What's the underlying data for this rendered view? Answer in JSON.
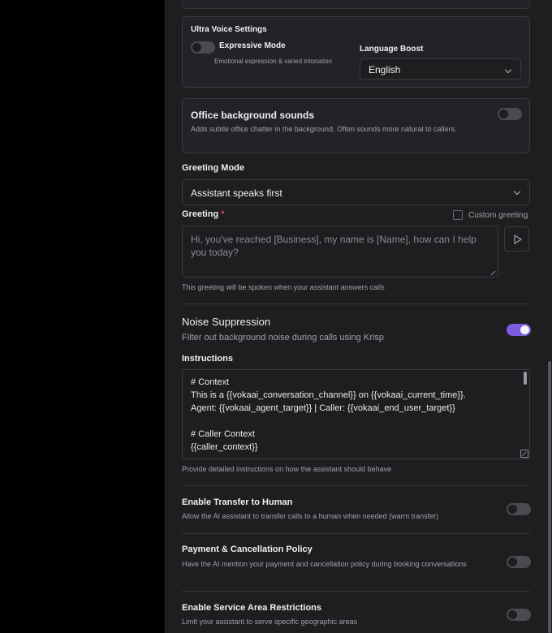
{
  "ultra_voice": {
    "heading": "Ultra Voice Settings",
    "expressive_mode": {
      "label": "Expressive Mode",
      "description": "Emotional expression & varied intonation",
      "enabled": false
    },
    "language_boost": {
      "label": "Language Boost",
      "value": "English"
    }
  },
  "office_sounds": {
    "title": "Office background sounds",
    "description": "Adds subtle office chatter in the background. Often sounds more natural to callers.",
    "enabled": false
  },
  "greeting_mode": {
    "label": "Greeting Mode",
    "value": "Assistant speaks first"
  },
  "greeting": {
    "label": "Greeting",
    "required_mark": "*",
    "custom_label": "Custom greeting",
    "custom_checked": false,
    "placeholder": "Hi, you've reached [Business], my name is [Name], how can I help you today?",
    "hint": "This greeting will be spoken when your assistant answers calls"
  },
  "noise_suppression": {
    "title": "Noise Suppression",
    "description": "Filter out background noise during calls using Krisp",
    "enabled": true
  },
  "instructions": {
    "label": "Instructions",
    "lines": [
      "# Context",
      "This is a {{vokaai_conversation_channel}} on {{vokaai_current_time}}.",
      "Agent: {{vokaai_agent_target}} | Caller: {{vokaai_end_user_target}}",
      "",
      "# Caller Context",
      "{{caller_context}}"
    ],
    "hint": "Provide detailed instructions on how the assistant should behave"
  },
  "transfer_to_human": {
    "title": "Enable Transfer to Human",
    "description": "Allow the AI assistant to transfer calls to a human when needed (warm transfer)",
    "enabled": false
  },
  "payment_policy": {
    "title": "Payment & Cancellation Policy",
    "description": "Have the AI mention your payment and cancellation policy during booking conversations",
    "enabled": false
  },
  "service_area": {
    "title": "Enable Service Area Restrictions",
    "description": "Limit your assistant to serve specific geographic areas",
    "enabled": false
  },
  "colors": {
    "accent": "#7c5ce0",
    "panel": "#1e1e21",
    "backdrop": "#000000"
  }
}
